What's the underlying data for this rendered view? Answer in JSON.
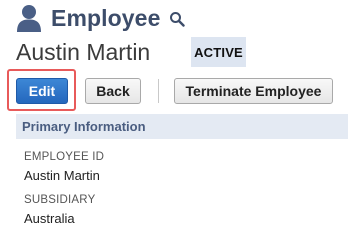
{
  "header": {
    "title": "Employee",
    "icons": {
      "record_type": "person-icon",
      "search": "search-icon"
    }
  },
  "record": {
    "name": "Austin Martin",
    "status": "ACTIVE"
  },
  "toolbar": {
    "edit_label": "Edit",
    "back_label": "Back",
    "terminate_label": "Terminate Employee"
  },
  "section": {
    "title": "Primary Information",
    "fields": [
      {
        "label": "EMPLOYEE ID",
        "value": "Austin Martin"
      },
      {
        "label": "SUBSIDIARY",
        "value": "Australia"
      }
    ]
  },
  "colors": {
    "title": "#3d4d6a",
    "primary_button": "#2c72c9",
    "highlight": "#e85a5a",
    "section_bar": "#e4eaf3",
    "status_badge": "#dde5f1"
  }
}
